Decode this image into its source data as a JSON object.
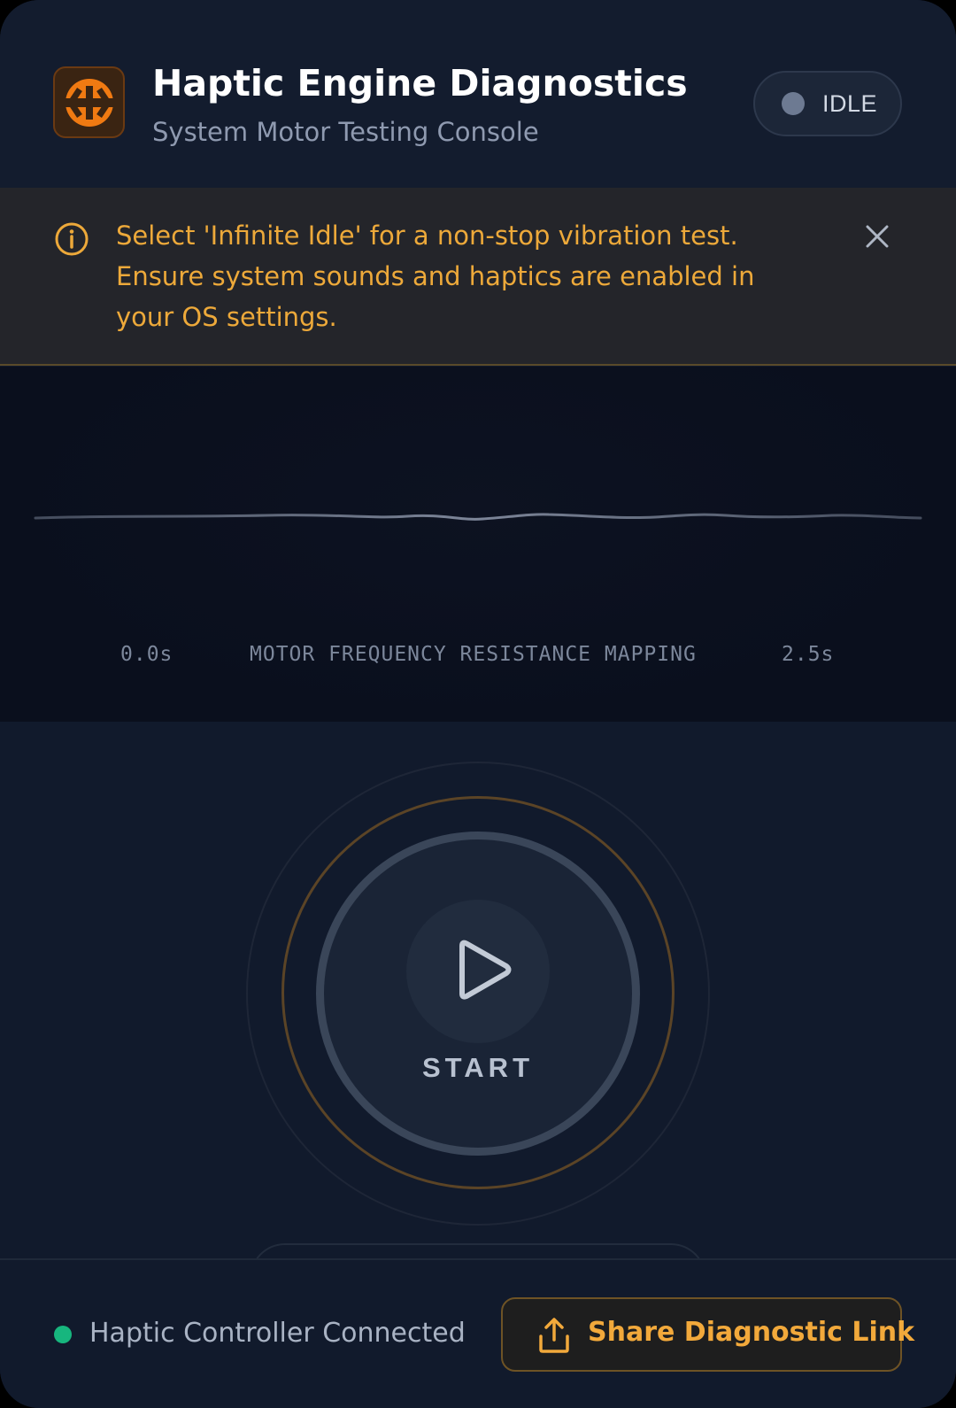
{
  "header": {
    "logo_icon": "haptic-engine-logo-icon",
    "title": "Haptic Engine Diagnostics",
    "subtitle": "System Motor Testing Console",
    "status": {
      "label": "IDLE",
      "dot_color": "#6d7a92"
    }
  },
  "alert": {
    "icon": "info-icon",
    "message": "Select 'Infinite Idle' for a non-stop vibration test. Ensure system sounds and haptics are enabled in your OS settings.",
    "close_icon": "close-icon",
    "color": "#eda93a"
  },
  "waveform": {
    "start_label": "0.0s",
    "center_label": "MOTOR FREQUENCY RESISTANCE MAPPING",
    "end_label": "2.5s"
  },
  "control": {
    "play_icon": "play-icon",
    "label": "START"
  },
  "footer": {
    "connection_text": "Haptic Controller Connected",
    "connection_color": "#17b67e",
    "share_icon": "share-upload-icon",
    "share_label": "Share Diagnostic Link",
    "accent": "#f2a93b"
  }
}
